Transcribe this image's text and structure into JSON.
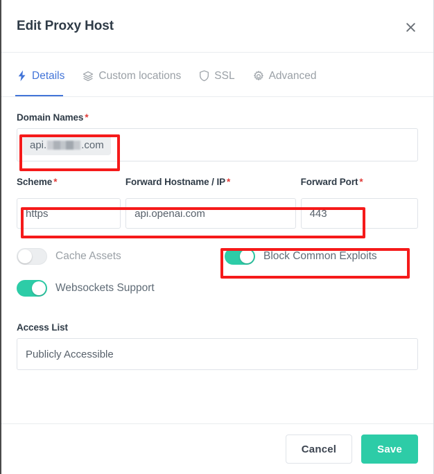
{
  "header": {
    "title": "Edit Proxy Host",
    "close_icon": "close-icon"
  },
  "tabs": [
    {
      "label": "Details",
      "icon": "bolt-icon",
      "active": true
    },
    {
      "label": "Custom locations",
      "icon": "layers-icon",
      "active": false
    },
    {
      "label": "SSL",
      "icon": "shield-icon",
      "active": false
    },
    {
      "label": "Advanced",
      "icon": "gear-icon",
      "active": false
    }
  ],
  "form": {
    "domain_names": {
      "label": "Domain Names",
      "required_marker": "*",
      "tag_prefix": "api.",
      "tag_suffix": ".com",
      "tag_redacted": true
    },
    "scheme": {
      "label": "Scheme",
      "required_marker": "*",
      "value": "https"
    },
    "forward_hostname": {
      "label": "Forward Hostname / IP",
      "required_marker": "*",
      "value": "api.openai.com"
    },
    "forward_port": {
      "label": "Forward Port",
      "required_marker": "*",
      "value": "443"
    },
    "toggles": [
      {
        "label": "Cache Assets",
        "on": false
      },
      {
        "label": "Block Common Exploits",
        "on": true
      },
      {
        "label": "Websockets Support",
        "on": true
      }
    ],
    "access_list": {
      "label": "Access List",
      "value": "Publicly Accessible"
    }
  },
  "footer": {
    "cancel_label": "Cancel",
    "save_label": "Save"
  },
  "colors": {
    "accent_teal": "#2dcca7",
    "tab_active_blue": "#4274d8",
    "required_red": "#e03b38",
    "annotation_red": "#f51a1a",
    "text_dark": "#2f3b47",
    "text_muted": "#9aa0a6"
  }
}
